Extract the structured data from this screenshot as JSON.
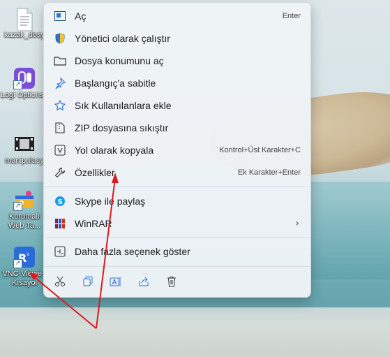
{
  "desktop": {
    "icons": [
      {
        "label": "kazak_dosy"
      },
      {
        "label": "Logi Options+"
      },
      {
        "label": "manipulasy"
      },
      {
        "label": "Korumalı Web Ta..."
      },
      {
        "label": "VNC-Viewe - Kısayol"
      }
    ]
  },
  "menu": {
    "items": [
      {
        "label": "Aç",
        "shortcut": "Enter",
        "icon": "open-icon"
      },
      {
        "label": "Yönetici olarak çalıştır",
        "shortcut": "",
        "icon": "shield-icon"
      },
      {
        "label": "Dosya konumunu aç",
        "shortcut": "",
        "icon": "folder-icon"
      },
      {
        "label": "Başlangıç'a sabitle",
        "shortcut": "",
        "icon": "pin-icon"
      },
      {
        "label": "Sık Kullanılanlara ekle",
        "shortcut": "",
        "icon": "star-icon"
      },
      {
        "label": "ZIP dosyasına sıkıştır",
        "shortcut": "",
        "icon": "zip-icon"
      },
      {
        "label": "Yol olarak kopyala",
        "shortcut": "Kontrol+Üst Karakter+C",
        "icon": "copy-path-icon"
      },
      {
        "label": "Özellikler",
        "shortcut": "Ek Karakter+Enter",
        "icon": "wrench-icon"
      },
      {
        "label": "Skype ile paylaş",
        "shortcut": "",
        "icon": "skype-icon"
      },
      {
        "label": "WinRAR",
        "shortcut": "",
        "icon": "winrar-icon"
      },
      {
        "label": "Daha fazla seçenek göster",
        "shortcut": "",
        "icon": "more-options-icon"
      }
    ],
    "toolbar": [
      "cut-icon",
      "copy-icon",
      "rename-icon",
      "share-icon",
      "delete-icon"
    ]
  }
}
